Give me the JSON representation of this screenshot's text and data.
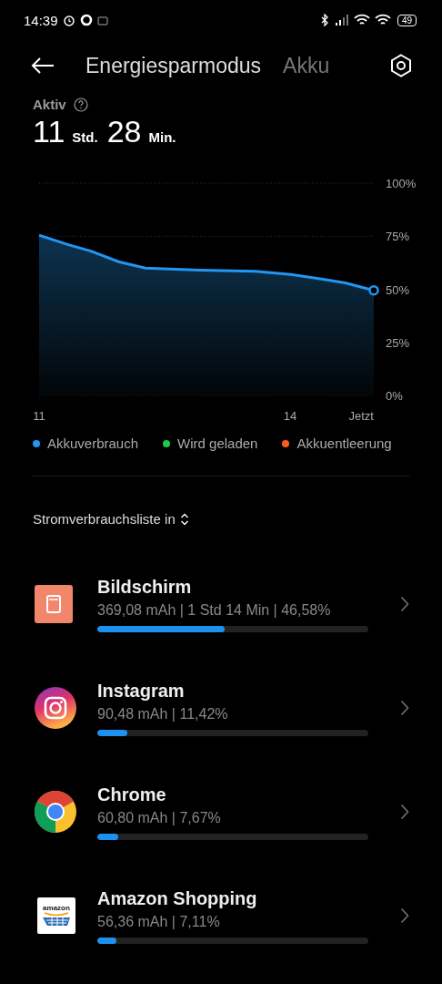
{
  "status_bar": {
    "time": "14:39",
    "battery": "49"
  },
  "header": {
    "tabs": [
      {
        "label": "Energiesparmodus",
        "selected": true
      },
      {
        "label": "Akku",
        "selected": false
      }
    ]
  },
  "active": {
    "label": "Aktiv",
    "hours": "11",
    "hours_unit": "Std.",
    "minutes": "28",
    "minutes_unit": "Min."
  },
  "chart": {
    "chart_data": {
      "type": "area",
      "x": [
        11,
        11.35,
        11.62,
        11.95,
        12.27,
        12.92,
        13.58,
        14.01,
        14.34,
        14.66,
        15
      ],
      "series": [
        {
          "color": "#2196f3",
          "values": [
            75.5,
            71,
            68,
            63,
            60,
            59,
            58.5,
            57,
            55,
            53,
            49.5
          ]
        }
      ],
      "xlim": [
        11,
        15
      ],
      "ylim": [
        0,
        100
      ],
      "xticks": [
        {
          "value": 11,
          "label": "11"
        },
        {
          "value": 14,
          "label": "14"
        },
        {
          "value": 15,
          "label": "Jetzt"
        }
      ],
      "yticks": [
        {
          "value": 100,
          "label": "100%"
        },
        {
          "value": 75,
          "label": "75%"
        },
        {
          "value": 50,
          "label": "50%"
        },
        {
          "value": 25,
          "label": "25%"
        },
        {
          "value": 0,
          "label": "0%"
        }
      ]
    }
  },
  "legend": [
    {
      "label": "Akkuverbrauch",
      "color": "#2196f3"
    },
    {
      "label": "Wird geladen",
      "color": "#1ec94a"
    },
    {
      "label": "Akkuentleerung",
      "color": "#ff5a1f"
    }
  ],
  "list_header": "Stromverbrauchsliste in",
  "apps": [
    {
      "kind": "screen",
      "name": "Bildschirm",
      "detail": "369,08 mAh | 1 Std 14 Min  | 46,58%",
      "level": 0.47
    },
    {
      "kind": "instagram",
      "name": "Instagram",
      "detail": "90,48 mAh | 11,42%",
      "level": 0.11
    },
    {
      "kind": "chrome",
      "name": "Chrome",
      "detail": "60,80 mAh | 7,67%",
      "level": 0.077
    },
    {
      "kind": "amazon",
      "name": "Amazon Shopping",
      "detail": "56,36 mAh | 7,11%",
      "level": 0.071,
      "logo_text": "amazon"
    }
  ]
}
